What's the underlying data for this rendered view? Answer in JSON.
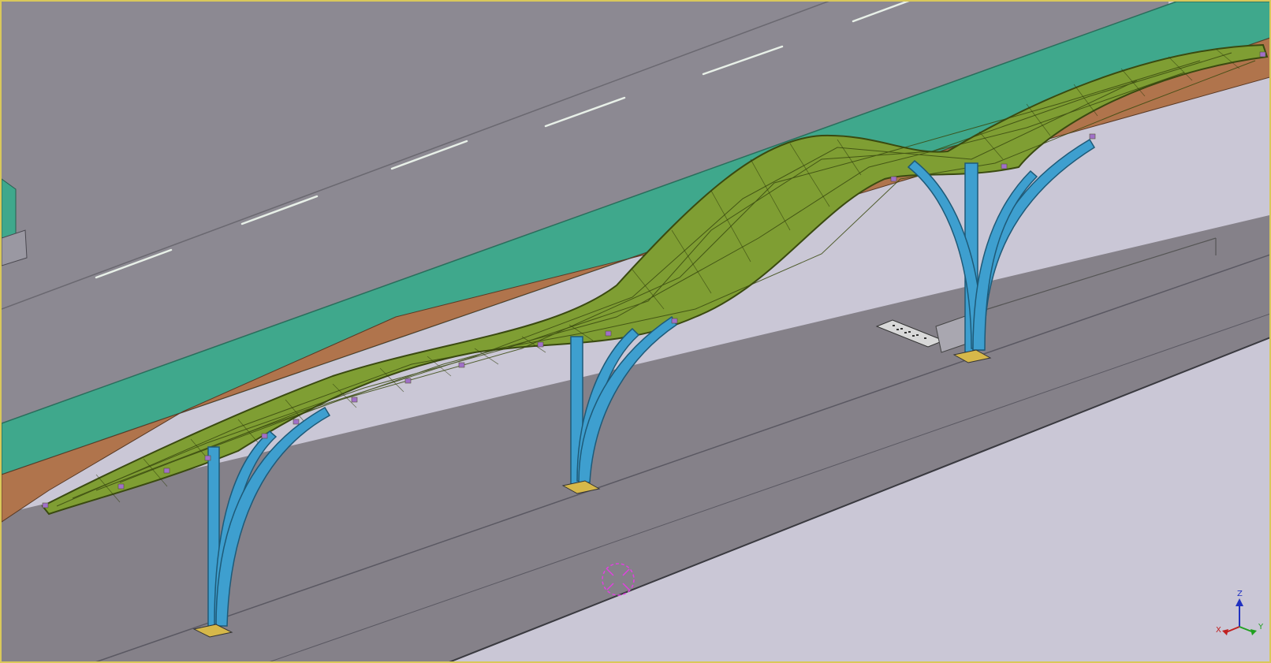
{
  "viewport": {
    "colors": {
      "road": "#8a8790",
      "platform": "#858189",
      "ground": "#cac7d6",
      "verge": "#3fa88c",
      "soil": "#b0744c",
      "roof_frame": "#7f9e33",
      "columns": "#3e9fcf",
      "base_plates": "#d6b84a",
      "lane_marking": "#e8f0e8",
      "frame_border": "#d9c85a",
      "cursor": "#e040e0"
    },
    "model": {
      "structure": "canopy",
      "roof": "triangulated-space-frame",
      "supports": 3,
      "column_style": "branching-tree",
      "lane_markings": "dashed"
    }
  },
  "axis_triad": {
    "z": "Z",
    "x": "X",
    "y": "Y"
  }
}
